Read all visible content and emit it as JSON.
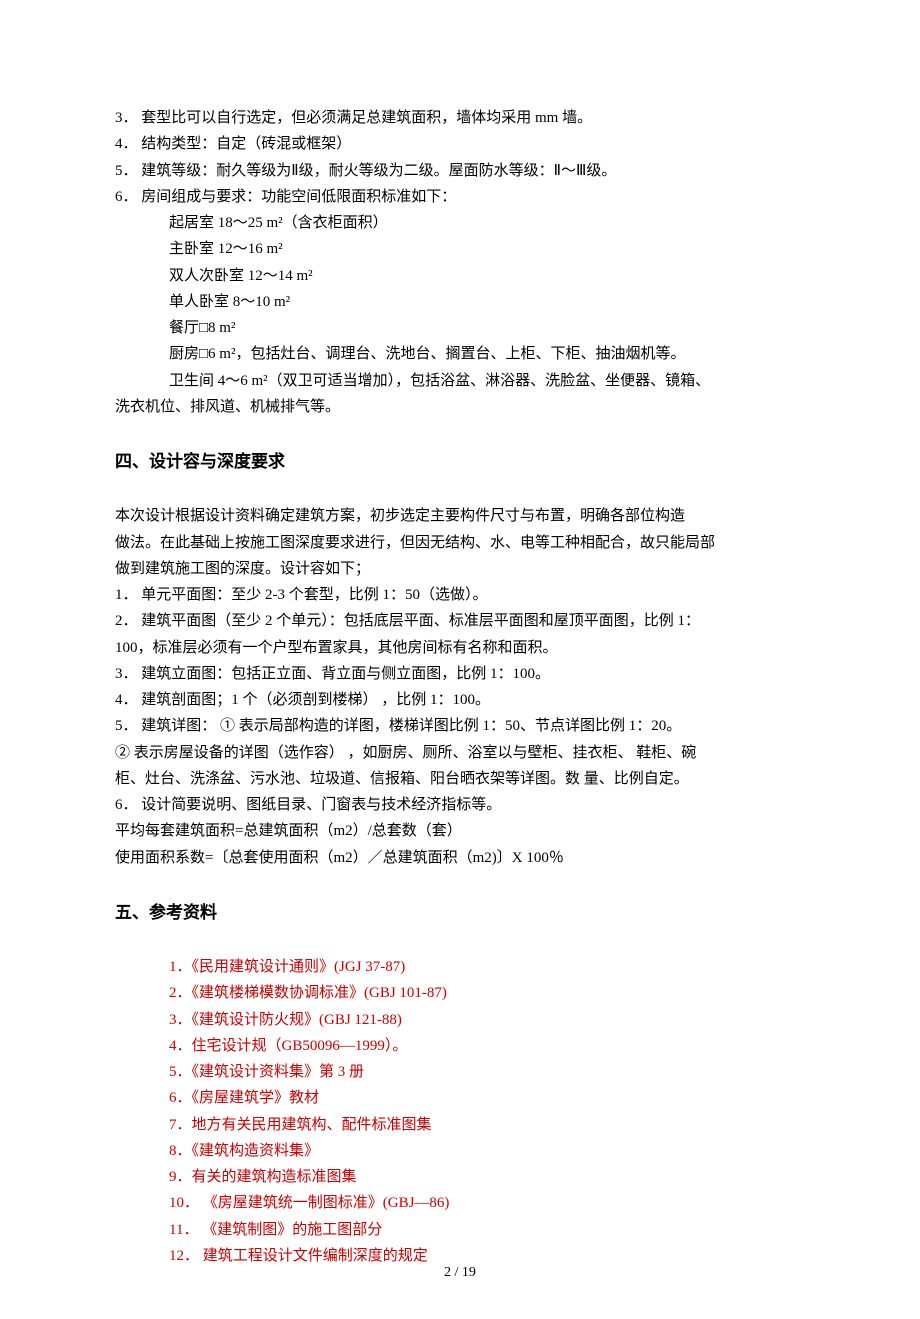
{
  "topList": [
    "3．  套型比可以自行选定，但必须满足总建筑面积，墙体均采用 mm 墙。",
    "4．  结构类型：自定（砖混或框架）",
    "5．  建筑等级：耐久等级为Ⅱ级，耐火等级为二级。屋面防水等级：Ⅱ～Ⅲ级。",
    "6．  房间组成与要求：功能空间低限面积标准如下："
  ],
  "rooms": [
    "起居室 18～25 m²（含衣柜面积）",
    "主卧室 12～16 m²",
    "双人次卧室 12～14 m²",
    "单人卧室 8～10 m²",
    "餐厅□8 m²",
    "厨房□6 m²，包括灶台、调理台、洗地台、搁置台、上柜、下柜、抽油烟机等。"
  ],
  "bathroomLines": [
    "卫生间 4～6 m²（双卫可适当增加），包括浴盆、淋浴器、洗脸盆、坐便器、镜箱、",
    "洗衣机位、排风道、机械排气等。"
  ],
  "heading4": "四、设计容与深度要求",
  "section4Intro": [
    "    本次设计根据设计资料确定建筑方案，初步选定主要构件尺寸与布置，明确各部位构造",
    "做法。在此基础上按施工图深度要求进行，但因无结构、水、电等工种相配合，故只能局部",
    "做到建筑施工图的深度。设计容如下；"
  ],
  "section4List": [
    "1．  单元平面图：至少 2-3 个套型，比例 1：50（选做）。",
    "2．  建筑平面图（至少 2 个单元）：包括底层平面、标准层平面图和屋顶平面图，比例 1：",
    "100，标准层必须有一个户型布置家具，其他房间标有名称和面积。",
    "3．  建筑立面图：包括正立面、背立面与侧立面图，比例 1：100。",
    "4．  建筑剖面图；1 个（必须剖到楼梯） ，比例 1：100。",
    "5．  建筑详图： ① 表示局部构造的详图，楼梯详图比例 1：50、节点详图比例 1：20。",
    "② 表示房屋设备的详图（选作容） ，如厨房、厕所、浴室以与壁柜、挂衣柜、 鞋柜、碗",
    "柜、灶台、洗涤盆、污水池、垃圾道、信报箱、阳台晒衣架等详图。数 量、比例自定。",
    "6．  设计简要说明、图纸目录、门窗表与技术经济指标等。",
    "平均每套建筑面积=总建筑面积（m2）/总套数（套）",
    "使用面积系数=〔总套使用面积（m2）／总建筑面积（m2)〕X 100％"
  ],
  "heading5": "五、参考资料",
  "refs": [
    "1．《民用建筑设计通则》(JGJ 37-87)",
    "2．《建筑楼梯模数协调标准》(GBJ 101-87)",
    "3．《建筑设计防火规》(GBJ 121-88)",
    "4．住宅设计规（GB50096—1999）。",
    "5．《建筑设计资料集》第 3 册",
    "6．《房屋建筑学》教材",
    "7．地方有关民用建筑构、配件标准图集",
    "8．《建筑构造资料集》",
    "9．有关的建筑构造标准图集",
    "10．  《房屋建筑统一制图标准》(GBJ—86)",
    "11．  《建筑制图》的施工图部分",
    "12．   建筑工程设计文件编制深度的规定"
  ],
  "pageNum": "2 / 19"
}
